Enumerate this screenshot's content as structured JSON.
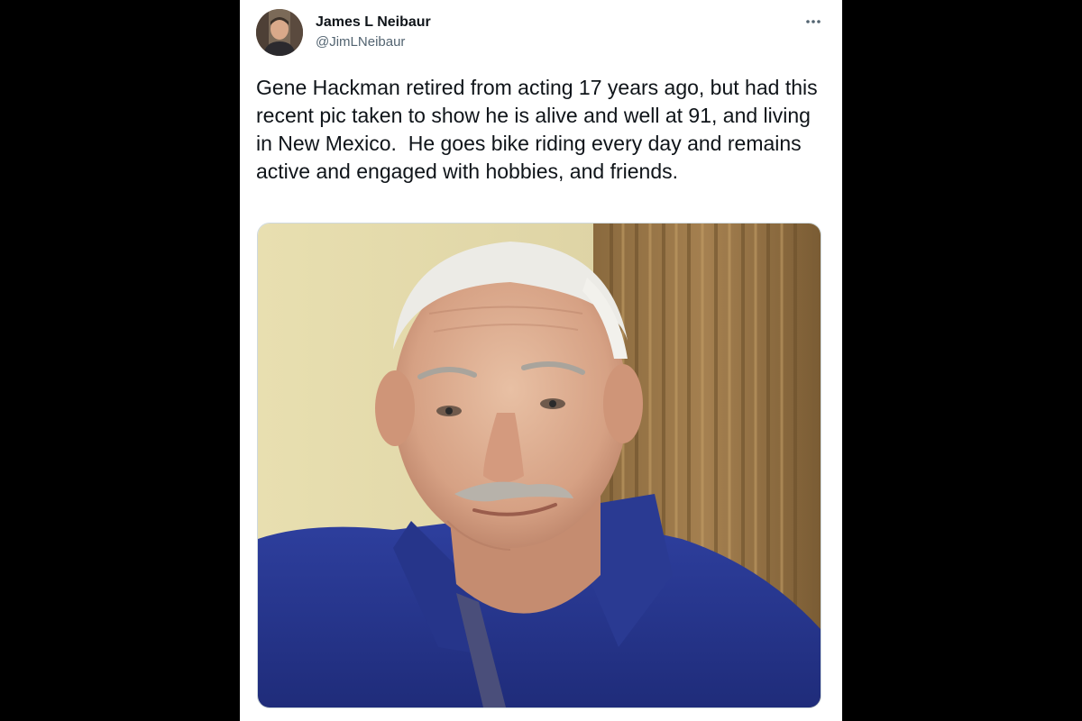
{
  "tweet": {
    "author": {
      "display_name": "James L Neibaur",
      "handle": "@JimLNeibaur",
      "avatar_icon": "avatar-photo"
    },
    "more_icon": "more-options-icon",
    "text": "Gene Hackman retired from acting 17 years ago, but had this recent pic taken to show he is alive and well at 91, and living in New Mexico.  He goes bike riding every day and remains active and engaged with hobbies, and friends.",
    "media": {
      "type": "photo",
      "subject": "portrait-photo"
    }
  },
  "colors": {
    "page_background": "#000000",
    "card_background": "#ffffff",
    "text_primary": "#0f1419",
    "text_secondary": "#536471",
    "border": "#cfd9de"
  }
}
